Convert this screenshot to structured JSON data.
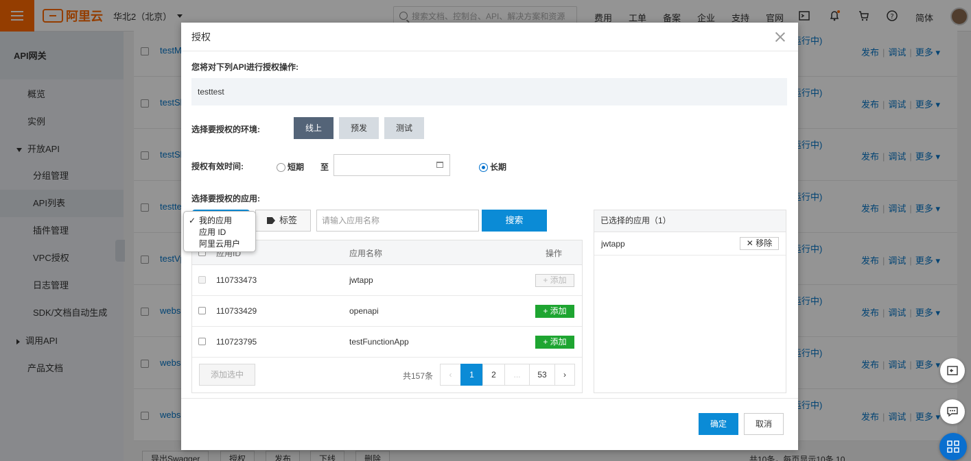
{
  "topbar": {
    "logo_text": "阿里云",
    "region": "华北2（北京）",
    "search_placeholder": "搜索文档、控制台、API、解决方案和资源",
    "nav": [
      "费用",
      "工单",
      "备案",
      "企业",
      "支持",
      "官网"
    ],
    "lang": "简体",
    "brand_color": "#ff6a00"
  },
  "sidebar": {
    "title": "API网关",
    "items": [
      {
        "label": "概览"
      },
      {
        "label": "实例"
      },
      {
        "label": "开放API"
      },
      {
        "label": "分组管理"
      },
      {
        "label": "API列表"
      },
      {
        "label": "插件管理"
      },
      {
        "label": "VPC授权"
      },
      {
        "label": "日志管理"
      },
      {
        "label": "SDK/文档自动生成"
      },
      {
        "label": "调用API"
      },
      {
        "label": "产品文档"
      }
    ]
  },
  "background_list": {
    "rows": [
      {
        "name": "testM",
        "status": "运行中)"
      },
      {
        "name": "testSl",
        "status": "运行中)"
      },
      {
        "name": "testSl",
        "status": "运行中)"
      },
      {
        "name": "testte",
        "status": "运行中)"
      },
      {
        "name": "testVp",
        "status": "运行中)"
      },
      {
        "name": "webs",
        "status": "运行中)"
      },
      {
        "name": "webs",
        "status": "运行中)"
      },
      {
        "name": "webs",
        "status": "运行中)"
      }
    ],
    "actions": [
      "发布",
      "调试",
      "更多"
    ],
    "footer_buttons": [
      "导出Swagger",
      "授权",
      "发布",
      "下线",
      "删除"
    ],
    "paging_text": "共10条，每页显示10条",
    "page_size": "10"
  },
  "modal": {
    "title": "授权",
    "api_label": "您将对下列API进行授权操作:",
    "api_name": "testtest",
    "env_label": "选择要授权的环境:",
    "envs": [
      "线上",
      "预发",
      "测试"
    ],
    "active_env": "线上",
    "validity_label": "授权有效时间:",
    "short_term": "短期",
    "to": "至",
    "long_term": "长期",
    "validity_selected": "长期",
    "app_label": "选择要授权的应用:",
    "tag_button": "标签",
    "app_search_placeholder": "请输入应用名称",
    "search_button": "搜索",
    "table": {
      "headers": {
        "id": "应用ID",
        "name": "应用名称",
        "op": "操作"
      },
      "rows": [
        {
          "id": "110733473",
          "name": "jwtapp",
          "action": "添加",
          "disabled": true
        },
        {
          "id": "110733429",
          "name": "openapi",
          "action": "添加",
          "disabled": false
        },
        {
          "id": "110723795",
          "name": "testFunctionApp",
          "action": "添加",
          "disabled": false
        }
      ],
      "add_selected": "添加选中",
      "total": "共157条",
      "pages": [
        "‹",
        "1",
        "2",
        "...",
        "53",
        "›"
      ],
      "current_page": "1"
    },
    "selected_panel": {
      "title": "已选择的应用（1）",
      "items": [
        {
          "name": "jwtapp",
          "action": "移除"
        }
      ]
    },
    "ok_button": "确定",
    "cancel_button": "取消",
    "accent_color": "#0b8bd6"
  },
  "dropdown": {
    "options": [
      "我的应用",
      "应用 ID",
      "阿里云用户"
    ],
    "selected": "我的应用"
  }
}
